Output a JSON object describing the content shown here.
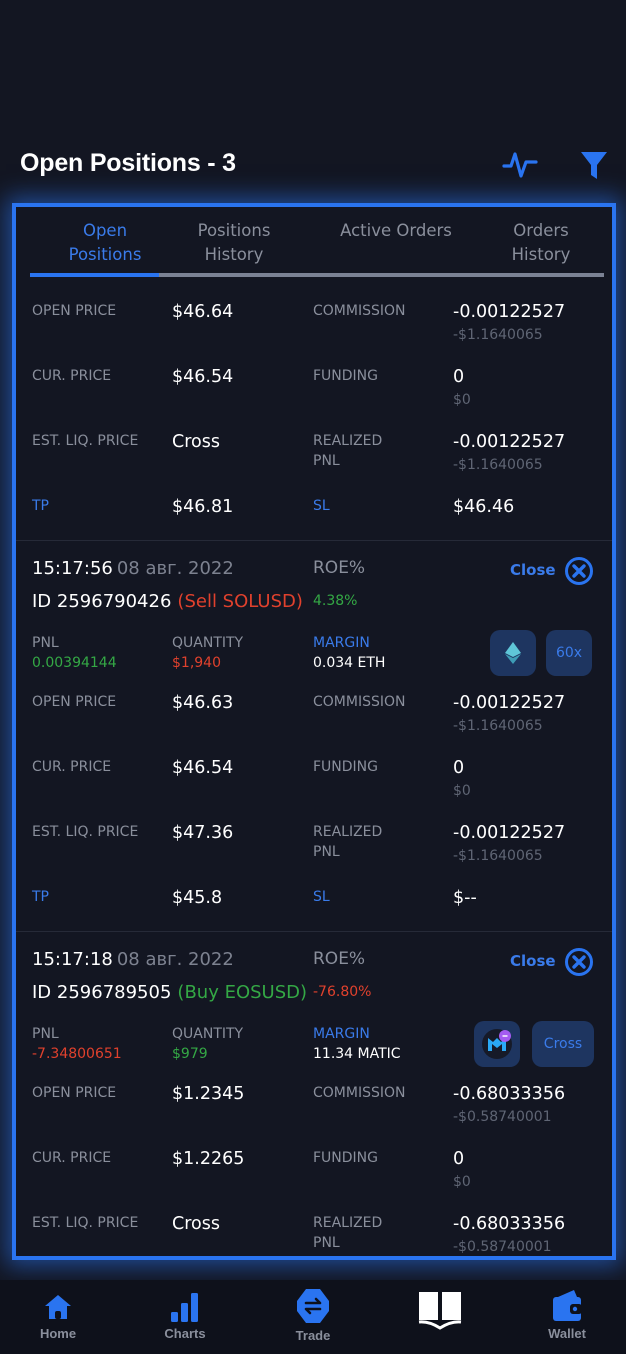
{
  "header": {
    "title": "Open Positions - 3",
    "icons": [
      "pulse-icon",
      "filter-icon"
    ]
  },
  "tabs": [
    {
      "label_line1": "Open",
      "label_line2": "Positions",
      "active": true
    },
    {
      "label_line1": "Positions",
      "label_line2": "History",
      "active": false
    },
    {
      "label_line1": "Active Orders",
      "label_line2": "",
      "active": false
    },
    {
      "label_line1": "Orders",
      "label_line2": "History",
      "active": false
    }
  ],
  "tab_scroll_fraction": 0.225,
  "labels": {
    "open_price": "OPEN PRICE",
    "cur_price": "CUR. PRICE",
    "est_liq_price": "EST. LIQ. PRICE",
    "tp": "TP",
    "commission": "COMMISSION",
    "funding": "FUNDING",
    "realized_1": "REALIZED",
    "realized_2": "PNL",
    "sl": "SL",
    "roe": "ROE%",
    "pnl": "PNL",
    "quantity": "QUANTITY",
    "margin": "MARGIN",
    "close": "Close"
  },
  "positions": [
    {
      "open_price": "$46.64",
      "cur_price": "$46.54",
      "est_liq_price": "Cross",
      "tp": "$46.81",
      "commission": "-0.00122527",
      "commission_usd": "-$1.1640065",
      "funding": "0",
      "funding_usd": "$0",
      "realized_pnl": "-0.00122527",
      "realized_pnl_usd": "-$1.1640065",
      "sl": "$46.46"
    },
    {
      "time": "15:17:56",
      "date": "08 авг. 2022",
      "id": "ID 2596790426",
      "side": "(Sell SOLUSD)",
      "roe": "4.38%",
      "pnl": "0.00394144",
      "quantity": "$1,940",
      "margin": "0.034 ETH",
      "coin_icon": "ethereum-icon",
      "leverage": "60x",
      "open_price": "$46.63",
      "cur_price": "$46.54",
      "est_liq_price": "$47.36",
      "tp": "$45.8",
      "commission": "-0.00122527",
      "commission_usd": "-$1.1640065",
      "funding": "0",
      "funding_usd": "$0",
      "realized_pnl": "-0.00122527",
      "realized_pnl_usd": "-$1.1640065",
      "sl": "$--"
    },
    {
      "time": "15:17:18",
      "date": "08 авг. 2022",
      "id": "ID 2596789505",
      "side": "(Buy EOSUSD)",
      "roe": "-76.80%",
      "pnl": "-7.34800651",
      "quantity": "$979",
      "margin": "11.34 MATIC",
      "coin_icon": "polygon-matic-icon",
      "leverage": "Cross",
      "open_price": "$1.2345",
      "cur_price": "$1.2265",
      "est_liq_price": "Cross",
      "commission": "-0.68033356",
      "commission_usd": "-$0.58740001",
      "funding": "0",
      "funding_usd": "$0",
      "realized_pnl": "-0.68033356",
      "realized_pnl_usd": "-$0.58740001"
    }
  ],
  "bottom_nav": [
    {
      "label": "Home",
      "icon": "home-icon"
    },
    {
      "label": "Charts",
      "icon": "bar-chart-icon"
    },
    {
      "label": "Trade",
      "icon": "trade-exchange-icon"
    },
    {
      "label": "",
      "icon": "book-icon"
    },
    {
      "label": "Wallet",
      "icon": "wallet-icon"
    }
  ],
  "colors": {
    "accent": "#2a74f0",
    "background": "#131622",
    "positive": "#34a845",
    "negative": "#e0412d",
    "muted": "#8a8f9c"
  }
}
